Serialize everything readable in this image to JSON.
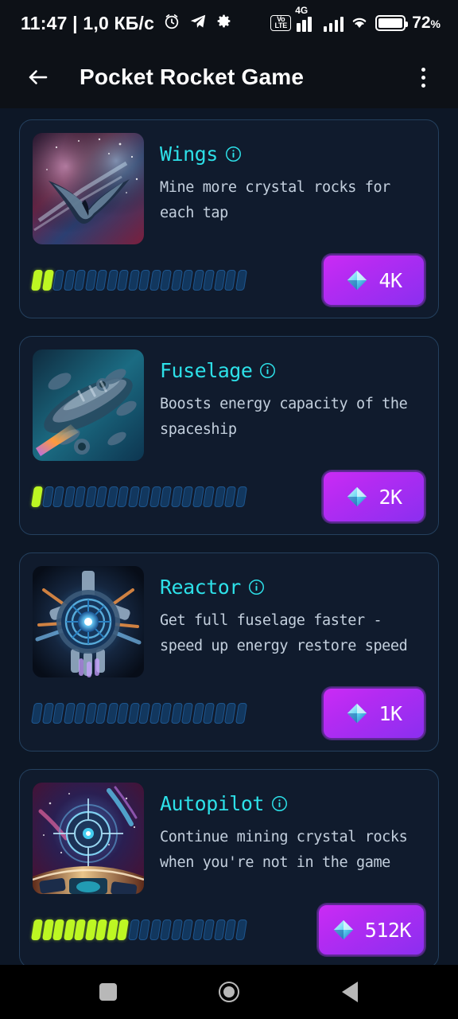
{
  "status_bar": {
    "time": "11:47",
    "separator": "|",
    "network_speed": "1,0 КБ/с",
    "alarm_icon": "alarm-clock-icon",
    "telegram_icon": "telegram-icon",
    "settings_icon": "gear-icon",
    "volte_line1": "Vo",
    "volte_line2": "LTE",
    "network_type": "4G",
    "wifi_icon": "wifi-icon",
    "battery_icon": "battery-icon",
    "battery_percent": "72",
    "battery_percent_symbol": "%"
  },
  "app_bar": {
    "back_icon": "back-arrow-icon",
    "title": "Pocket Rocket Game",
    "menu_icon": "overflow-menu-icon"
  },
  "colors": {
    "page_bg": "#0d1726",
    "card_bg": "#101b2d",
    "card_border": "#24405e",
    "title_cyan": "#2de0e8",
    "desc_gray": "#c3cfdd",
    "segment_on": "#bdf723",
    "segment_off": "#12375e",
    "button_purple_start": "#cb2bf5",
    "button_purple_end": "#8b2ff0",
    "gem_cyan": "#6fe3f5"
  },
  "upgrades": [
    {
      "name": "Wings",
      "description": "Mine more crystal rocks for each tap",
      "info_icon": "info-icon",
      "thumbnail": "winged-spaceship-nebula-thumbnail",
      "segments_total": 20,
      "segments_filled": 2,
      "price": "4K",
      "gem_icon": "crystal-gem-icon"
    },
    {
      "name": "Fuselage",
      "description": "Boosts energy capacity of the spaceship",
      "info_icon": "info-icon",
      "thumbnail": "spaceship-fuselage-thumbnail",
      "segments_total": 20,
      "segments_filled": 1,
      "price": "2K",
      "gem_icon": "crystal-gem-icon"
    },
    {
      "name": "Reactor",
      "description": "Get full fuselage faster - speed up energy restore speed",
      "info_icon": "info-icon",
      "thumbnail": "reactor-core-thumbnail",
      "segments_total": 20,
      "segments_filled": 0,
      "price": "1K",
      "gem_icon": "crystal-gem-icon"
    },
    {
      "name": "Autopilot",
      "description": "Continue mining crystal rocks when you're not in the game",
      "info_icon": "info-icon",
      "thumbnail": "autopilot-cockpit-thumbnail",
      "segments_total": 20,
      "segments_filled": 9,
      "price": "512K",
      "gem_icon": "crystal-gem-icon"
    }
  ],
  "nav_bar": {
    "recents_icon": "recents-square-icon",
    "home_icon": "home-circle-icon",
    "back_icon": "back-triangle-icon"
  }
}
